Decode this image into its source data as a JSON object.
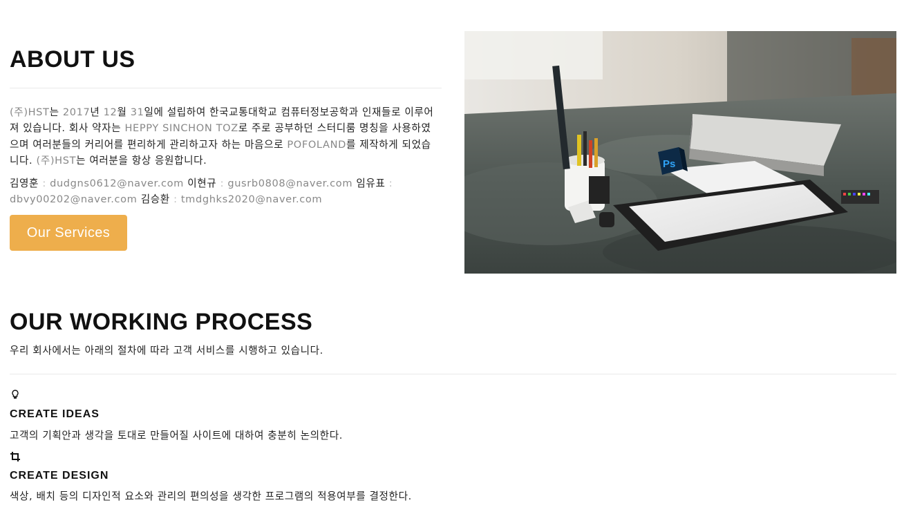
{
  "about": {
    "title": "ABOUT US",
    "desc": {
      "p1": "(주)HST",
      "p2": "는 ",
      "p3": "2017",
      "p4": "년 ",
      "p5": "12",
      "p6": "월 ",
      "p7": "31",
      "p8": "일에 설립하여 한국교통대학교 컴퓨터정보공학과 인재들로 이루어져 있습니다. 회사 약자는 ",
      "p9": "HEPPY SINCHON TOZ",
      "p10": "로 주로 공부하던 스터디룸 명칭을 사용하였으며 여러분들의 커리어를 편리하게 관리하고자 하는 마음으로 ",
      "p11": "POFOLAND",
      "p12": "를 제작하게 되었습니다. ",
      "p13": "(주)HST",
      "p14": "는 여러분을 항상 응원합니다."
    },
    "contacts": [
      {
        "name": "김영훈",
        "email": "dudgns0612@naver.com"
      },
      {
        "name": "이현규",
        "email": "gusrb0808@naver.com"
      },
      {
        "name": "임유표",
        "email": "dbvy00202@naver.com"
      },
      {
        "name": "김승환",
        "email": "tmdghks2020@naver.com"
      }
    ],
    "separator": " : ",
    "button_label": "Our Services"
  },
  "hero": {
    "ps_label": "Ps"
  },
  "process": {
    "title": "OUR WORKING PROCESS",
    "subtitle": "우리 회사에서는 아래의 절차에 따라 고객 서비스를 시행하고 있습니다.",
    "steps": [
      {
        "icon": "lightbulb-icon",
        "title": "CREATE IDEAS",
        "desc": "고객의 기획안과 생각을 토대로 만들어질 사이트에 대하여 충분히 논의한다."
      },
      {
        "icon": "crop-icon",
        "title": "CREATE DESIGN",
        "desc": "색상, 배치 등의 디자인적 요소와 관리의 편의성을 생각한 프로그램의 적용여부를 결정한다."
      }
    ]
  },
  "colors": {
    "accent": "#eeae4c",
    "ps_blue": "#2fa3f6",
    "muted_text": "#888888"
  }
}
